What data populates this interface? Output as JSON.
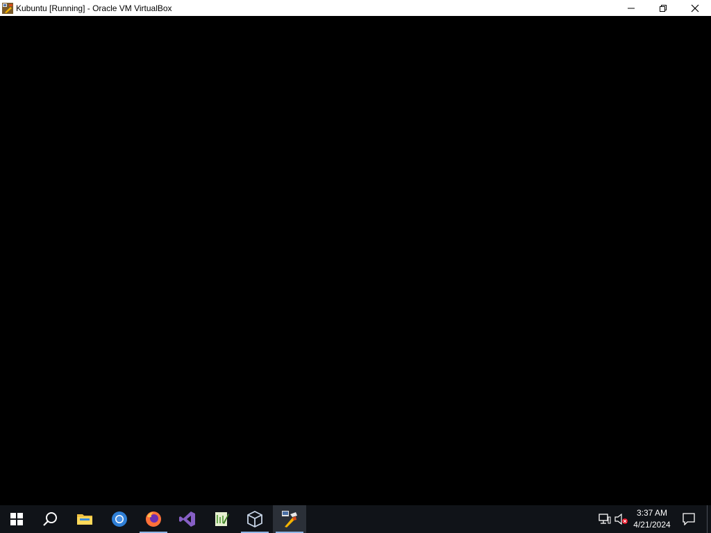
{
  "window": {
    "title": "Kubuntu [Running] - Oracle VM VirtualBox",
    "icon": "virtualbox-vm-icon",
    "buttons": {
      "minimize": "minimize-icon",
      "restore": "restore-icon",
      "close": "close-icon"
    }
  },
  "vm_screen": {
    "state": "black"
  },
  "taskbar": {
    "pinned": [
      {
        "name": "start-button",
        "icon": "windows-icon"
      },
      {
        "name": "search-button",
        "icon": "search-icon"
      },
      {
        "name": "file-explorer",
        "icon": "folder-icon"
      },
      {
        "name": "chrome",
        "icon": "chrome-icon"
      },
      {
        "name": "firefox",
        "icon": "firefox-icon"
      },
      {
        "name": "visual-studio",
        "icon": "visual-studio-icon"
      },
      {
        "name": "notepad-plus-plus",
        "icon": "notepad-icon"
      },
      {
        "name": "virtualbox-manager",
        "icon": "virtualbox-icon"
      },
      {
        "name": "virtualbox-vm",
        "icon": "virtualbox-vm-icon",
        "active": true
      }
    ],
    "tray": {
      "network_icon": "network-icon",
      "volume_icon": "volume-muted-icon",
      "time": "3:37 AM",
      "date": "4/21/2024",
      "notification_icon": "notification-icon"
    },
    "colors": {
      "background": "#101318",
      "active_underline": "#8fb6e6"
    }
  }
}
